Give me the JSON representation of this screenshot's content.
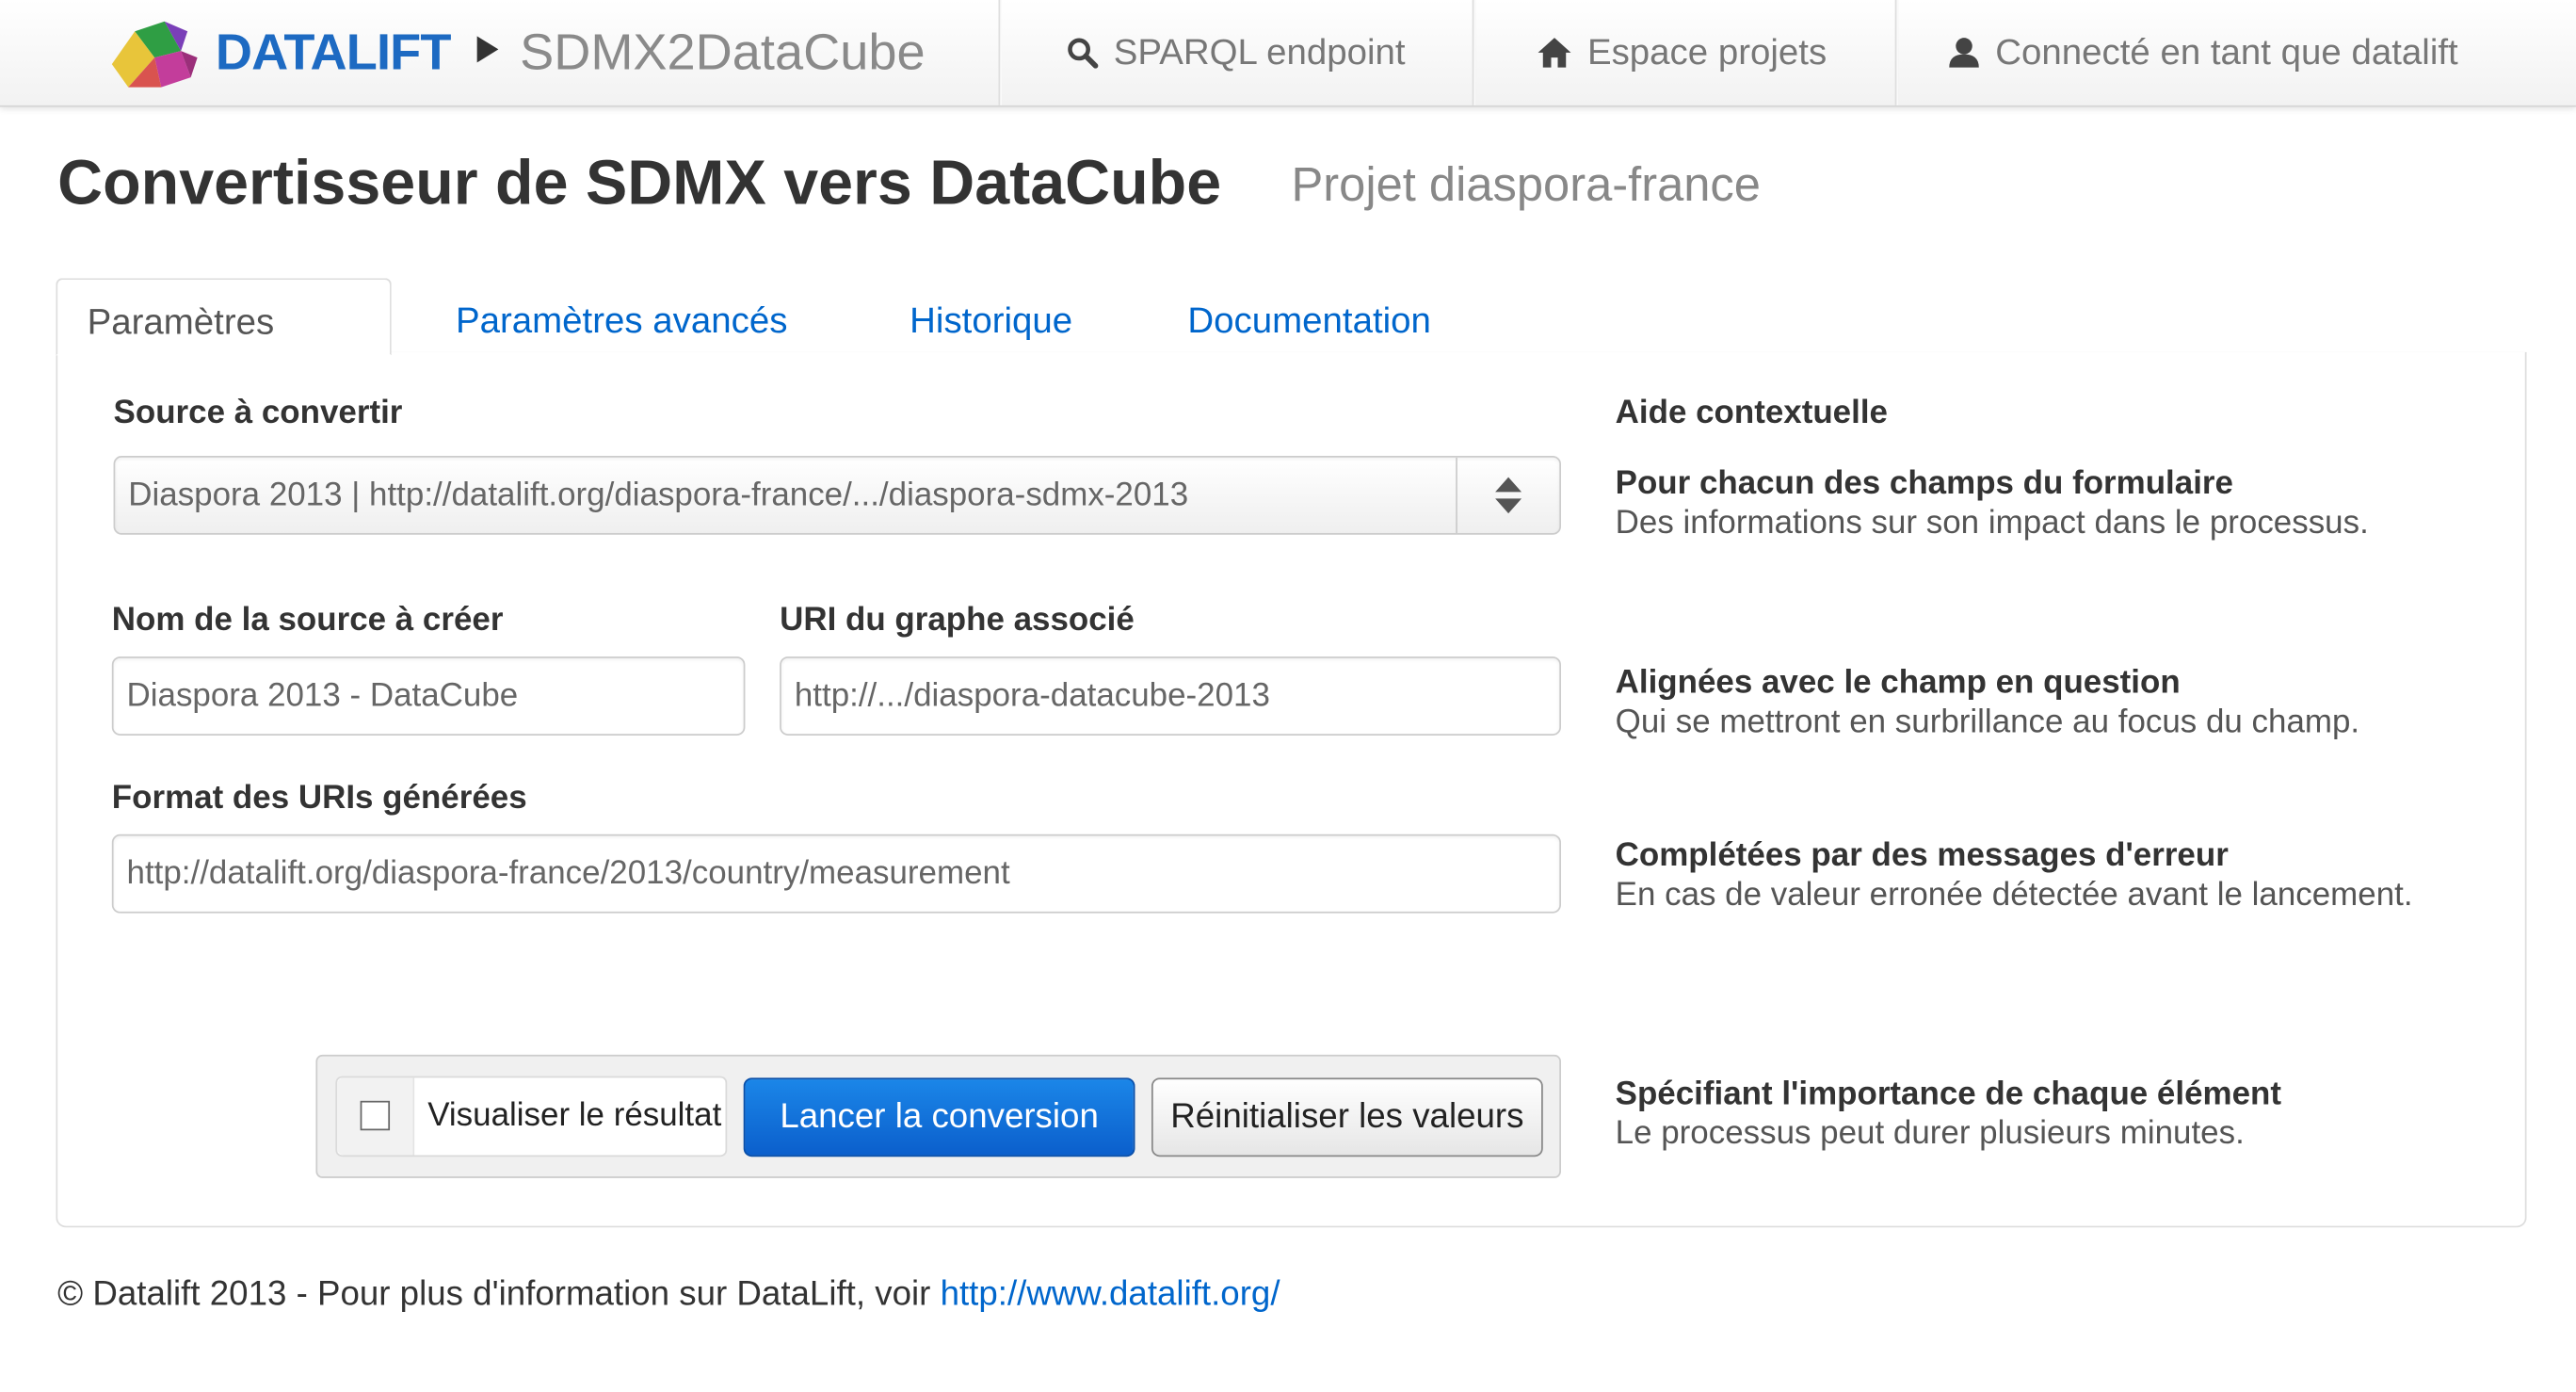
{
  "navbar": {
    "brand": "DATALIFT",
    "module": "SDMX2DataCube",
    "items": [
      {
        "icon": "search-icon",
        "label": "SPARQL endpoint"
      },
      {
        "icon": "home-icon",
        "label": "Espace projets"
      },
      {
        "icon": "user-icon",
        "label": "Connecté en tant que datalift"
      }
    ]
  },
  "header": {
    "title": "Convertisseur de SDMX vers DataCube",
    "project": "Projet diaspora-france"
  },
  "tabs": [
    {
      "label": "Paramètres",
      "active": true
    },
    {
      "label": "Paramètres avancés",
      "active": false
    },
    {
      "label": "Historique",
      "active": false
    },
    {
      "label": "Documentation",
      "active": false
    }
  ],
  "form": {
    "source_label": "Source à convertir",
    "source_value": "Diaspora 2013 | http://datalift.org/diaspora-france/.../diaspora-sdmx-2013",
    "name_label": "Nom de la source à créer",
    "name_value": "Diaspora 2013 - DataCube",
    "graph_label": "URI du graphe associé",
    "graph_value": "http://.../diaspora-datacube-2013",
    "format_label": "Format des URIs générées",
    "format_value": "http://datalift.org/diaspora-france/2013/country/measurement"
  },
  "help": {
    "title": "Aide contextuelle",
    "items": [
      {
        "heading": "Pour chacun des champs du formulaire",
        "text": "Des informations sur son impact dans le processus."
      },
      {
        "heading": "Alignées avec le champ en question",
        "text": "Qui se mettront en surbrillance au focus du champ."
      },
      {
        "heading": "Complétées par des messages d'erreur",
        "text": "En cas de valeur erronée détectée avant le lancement."
      },
      {
        "heading": "Spécifiant l'importance de chaque élément",
        "text": "Le processus peut durer plusieurs minutes."
      }
    ]
  },
  "actions": {
    "checkbox_label": "Visualiser le résultat",
    "checkbox_checked": false,
    "submit_label": "Lancer la conversion",
    "reset_label": "Réinitialiser les valeurs"
  },
  "footer": {
    "text": "© Datalift 2013 - Pour plus d'information sur DataLift, voir ",
    "link": "http://www.datalift.org/"
  },
  "colors": {
    "brand": "#1d6ac2",
    "link": "#0066cc",
    "primary_button": "#0b5fcc"
  }
}
